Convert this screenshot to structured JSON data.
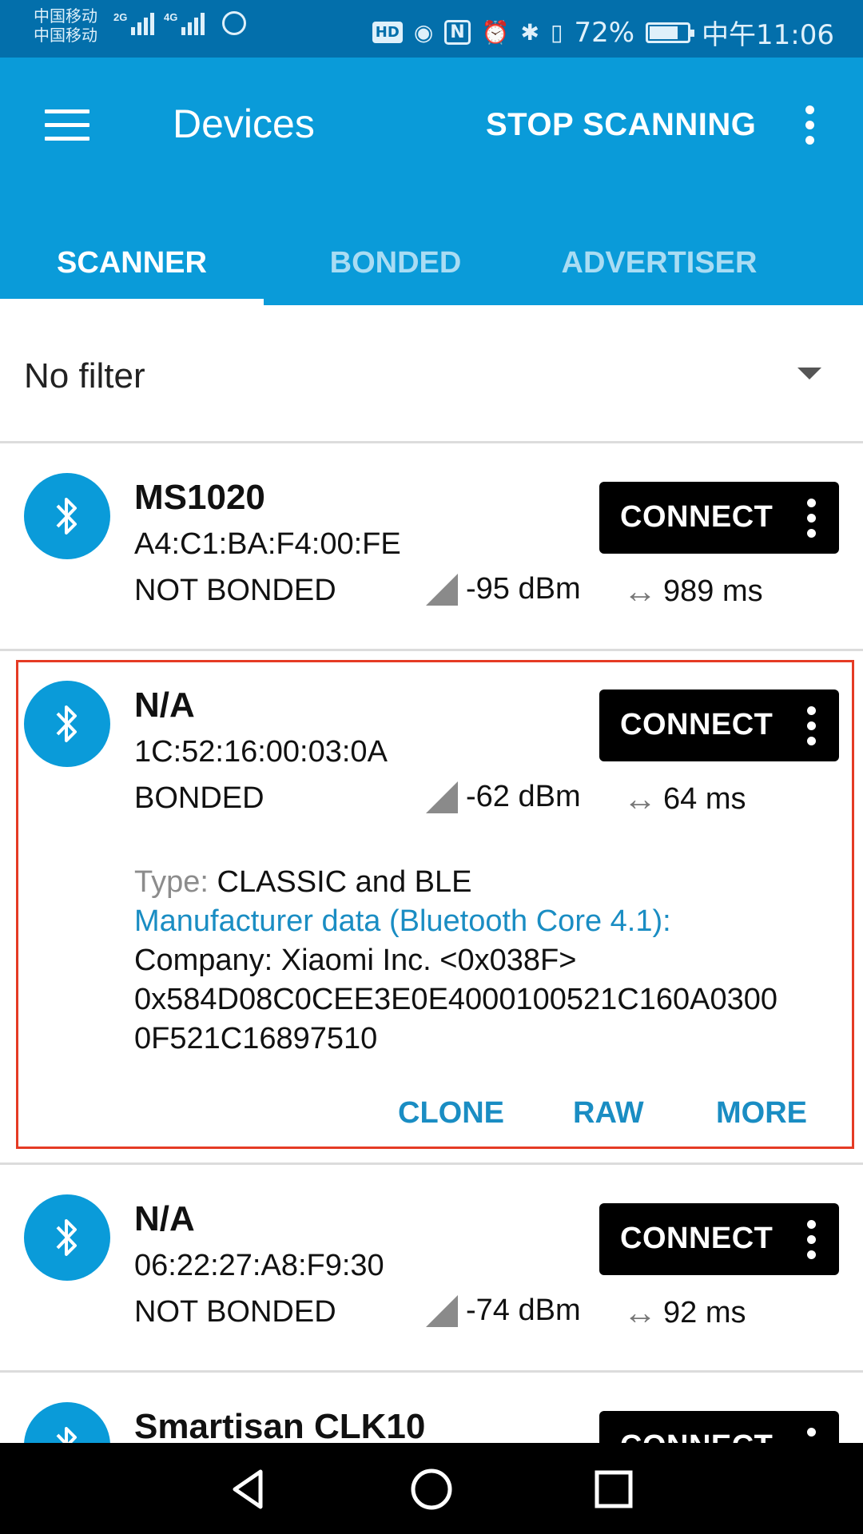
{
  "status_bar": {
    "carrier_1": "中国移动",
    "carrier_2": "中国移动",
    "net_1": "2G",
    "net_2": "4G",
    "hd": "HD",
    "nfc": "N",
    "battery_percent": "72%",
    "battery_level": 0.72,
    "time": "中午11:06"
  },
  "appbar": {
    "title": "Devices",
    "stop_scanning_label": "STOP SCANNING"
  },
  "tabs": [
    {
      "label": "SCANNER"
    },
    {
      "label": "BONDED"
    },
    {
      "label": "ADVERTISER"
    }
  ],
  "filter": {
    "label": "No filter"
  },
  "devices": [
    {
      "name": "MS1020",
      "address": "A4:C1:BA:F4:00:FE",
      "bond_state": "NOT BONDED",
      "rssi": "-95 dBm",
      "interval": "989 ms",
      "connect_label": "CONNECT"
    },
    {
      "name": "N/A",
      "address": "1C:52:16:00:03:0A",
      "bond_state": "BONDED",
      "rssi": "-62 dBm",
      "interval": "64 ms",
      "connect_label": "CONNECT",
      "type_key": "Type: ",
      "type_value": "CLASSIC and BLE",
      "mfr_title": "Manufacturer data (Bluetooth Core 4.1):",
      "company": "Company: Xiaomi Inc. <0x038F>",
      "data_line_1": "0x584D08C0CEE3E0E4000100521C160A0300",
      "data_line_2": "0F521C16897510",
      "actions": [
        "CLONE",
        "RAW",
        "MORE"
      ]
    },
    {
      "name": "N/A",
      "address": "06:22:27:A8:F9:30",
      "bond_state": "NOT BONDED",
      "rssi": "-74 dBm",
      "interval": "92 ms",
      "connect_label": "CONNECT"
    },
    {
      "name": "Smartisan CLK10",
      "connect_label": "CONNECT"
    }
  ],
  "colors": {
    "primary": "#0a9bd9",
    "primary_dark": "#036fab",
    "link": "#1a8dc3",
    "highlight": "#e53b24"
  }
}
